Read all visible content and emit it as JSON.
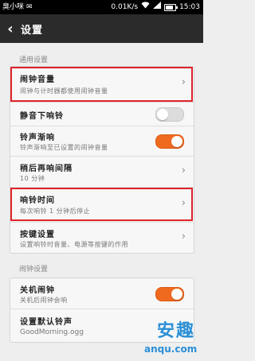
{
  "status_bar": {
    "carrier": "臭小咪",
    "speed": "0.01K/s",
    "time": "15:03",
    "icons": [
      "message-icon",
      "wifi-icon",
      "signal-icon",
      "battery-icon"
    ]
  },
  "title_bar": {
    "title": "设置",
    "back_icon": "chevron-left-icon"
  },
  "sections": [
    {
      "label": "通用设置",
      "items": [
        {
          "title": "闹钟音量",
          "subtitle": "闹钟与计时器都使用闹钟音量",
          "control": "chevron"
        },
        {
          "title": "静音下响铃",
          "subtitle": "",
          "control": "toggle",
          "on": false
        },
        {
          "title": "铃声渐响",
          "subtitle": "铃声渐响至已设置的闹钟音量",
          "control": "toggle",
          "on": true
        },
        {
          "title": "稍后再响间隔",
          "subtitle": "10 分钟",
          "control": "chevron"
        },
        {
          "title": "响铃时间",
          "subtitle": "每次响铃 1 分钟后停止",
          "control": "chevron"
        },
        {
          "title": "按键设置",
          "subtitle": "设置响铃时音量、电源等按键的作用",
          "control": "chevron"
        }
      ]
    },
    {
      "label": "闹钟设置",
      "items": [
        {
          "title": "关机闹钟",
          "subtitle": "关机后闹钟会响",
          "control": "toggle",
          "on": true
        },
        {
          "title": "设置默认铃声",
          "subtitle": "GoodMorning.ogg",
          "control": "chevron"
        }
      ]
    }
  ],
  "watermark": {
    "main": "安趣",
    "url": "anqu.com"
  },
  "colors": {
    "accent": "#ef6a1f",
    "highlight": "#e0222a",
    "title_bar": "#2b2b2b"
  }
}
